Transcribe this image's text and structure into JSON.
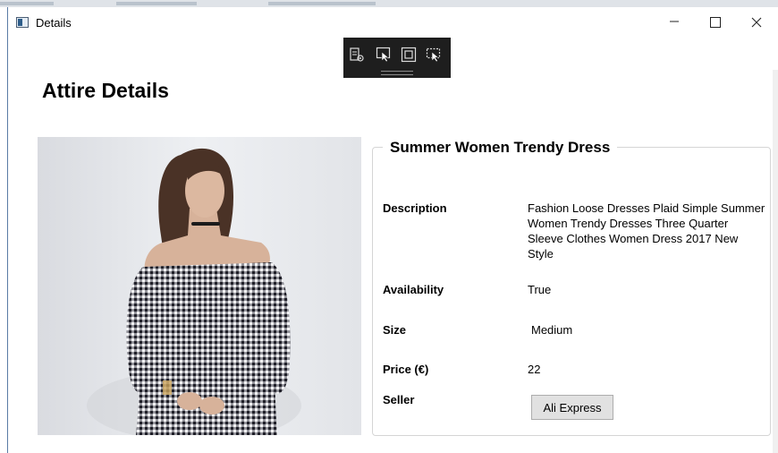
{
  "window": {
    "title": "Details",
    "controls": {
      "minimize": "—",
      "maximize": "☐",
      "close": "✕"
    }
  },
  "debug_toolbar": {
    "tools": [
      "live-visual-tree-icon",
      "select-element-icon",
      "display-layout-adorners-icon",
      "track-focused-element-icon"
    ]
  },
  "page": {
    "title": "Attire Details"
  },
  "product": {
    "name": "Summer Women Trendy Dress",
    "fields": {
      "description_label": "Description",
      "description_value": "Fashion Loose Dresses Plaid Simple Summer Women Trendy Dresses Three Quarter Sleeve Clothes Women Dress 2017 New Style",
      "availability_label": "Availability",
      "availability_value": "True",
      "size_label": "Size",
      "size_value": "Medium",
      "price_label": "Price (€)",
      "price_value": "22",
      "seller_label": "Seller",
      "seller_button": "Ali Express"
    }
  },
  "colors": {
    "toolbar_bg": "#1e1e1e",
    "button_bg": "#e1e1e1",
    "group_border": "#d5d5d5"
  }
}
